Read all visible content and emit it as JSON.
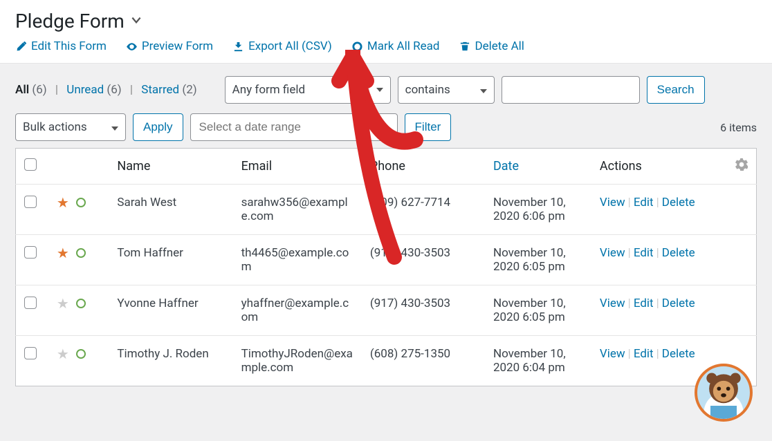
{
  "header": {
    "title": "Pledge Form",
    "links": {
      "edit": "Edit This Form",
      "preview": "Preview Form",
      "export": "Export All (CSV)",
      "mark_read": "Mark All Read",
      "delete_all": "Delete All"
    }
  },
  "filters": {
    "tabs": {
      "all_label": "All",
      "all_count": "(6)",
      "unread_label": "Unread",
      "unread_count": "(6)",
      "starred_label": "Starred",
      "starred_count": "(2)"
    },
    "field_select": "Any form field",
    "operator_select": "contains",
    "search_value": "",
    "search_button": "Search",
    "bulk_select": "Bulk actions",
    "apply_button": "Apply",
    "date_placeholder": "Select a date range",
    "filter_button": "Filter",
    "items_count": "6 items"
  },
  "table": {
    "headers": {
      "name": "Name",
      "email": "Email",
      "phone": "Phone",
      "date": "Date",
      "actions": "Actions"
    },
    "action_labels": {
      "view": "View",
      "edit": "Edit",
      "delete": "Delete"
    },
    "rows": [
      {
        "starred": true,
        "name": "Sarah West",
        "email": "sarahw356@example.com",
        "phone": "(209) 627-7714",
        "date": "November 10, 2020 6:06 pm"
      },
      {
        "starred": true,
        "name": "Tom Haffner",
        "email": "th4465@example.com",
        "phone": "(917) 430-3503",
        "date": "November 10, 2020 6:05 pm"
      },
      {
        "starred": false,
        "name": "Yvonne Haffner",
        "email": "yhaffner@example.com",
        "phone": "(917) 430-3503",
        "date": "November 10, 2020 6:05 pm"
      },
      {
        "starred": false,
        "name": "Timothy J. Roden",
        "email": "TimothyJRoden@example.com",
        "phone": "(608) 275-1350",
        "date": "November 10, 2020 6:04 pm"
      }
    ]
  }
}
